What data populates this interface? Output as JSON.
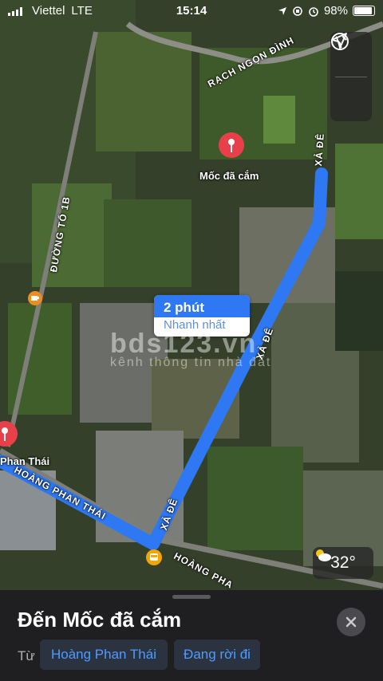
{
  "status_bar": {
    "carrier": "Viettel",
    "network": "LTE",
    "time": "15:14",
    "battery": "98%"
  },
  "map": {
    "roads": {
      "rach_ngon_dinh": "RẠCH NGỌN ĐÌNH",
      "xa_de_top": "XẢ ĐÊ",
      "xa_de_middle": "XẢ ĐÊ",
      "xa_de_bottom": "XẢ ĐÊ",
      "duong_to_1b": "ĐƯỜNG TỔ 1B",
      "hoang_phan_thai_left": "HOÀNG PHAN THÁI",
      "hoang_phan_thai_bottom": "HOÀNG PHA"
    },
    "destination_pin_label": "Mốc đã cắm",
    "origin_pin_label": "Phan Thái",
    "route_callout": {
      "duration": "2 phút",
      "description": "Nhanh nhất"
    },
    "watermark": {
      "main": "bds123.vn",
      "sub": "kênh thông tin nhà đất"
    },
    "weather": {
      "temperature": "32°",
      "icon": "partly-cloudy-icon"
    },
    "controls": [
      "globe-icon",
      "location-arrow-icon"
    ],
    "route_color": "#2f78f3"
  },
  "sheet": {
    "title": "Đến Mốc đã cắm",
    "from_label": "Từ",
    "origin_chip": "Hoàng Phan Thái",
    "depart_chip": "Đang rời đi"
  }
}
